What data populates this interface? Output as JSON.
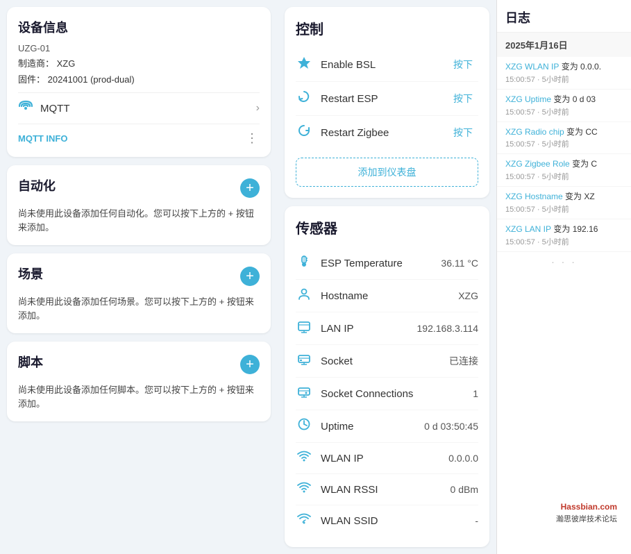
{
  "left": {
    "device_info": {
      "title": "设备信息",
      "model": "UZG-01",
      "manufacturer_label": "制造商：",
      "manufacturer": "XZG",
      "firmware_label": "固件：",
      "firmware": "20241001 (prod-dual)",
      "mqtt_label": "MQTT",
      "mqtt_info_label": "MQTT INFO"
    },
    "automation": {
      "title": "自动化",
      "text": "尚未使用此设备添加任何自动化。您可以按下上方的 + 按钮来添加。"
    },
    "scene": {
      "title": "场景",
      "text": "尚未使用此设备添加任何场景。您可以按下上方的 + 按钮来添加。"
    },
    "script": {
      "title": "脚本",
      "text": "尚未使用此设备添加任何脚本。您可以按下上方的 + 按钮来添加。"
    }
  },
  "center": {
    "control": {
      "title": "控制",
      "items": [
        {
          "label": "Enable BSL",
          "btn": "按下"
        },
        {
          "label": "Restart ESP",
          "btn": "按下"
        },
        {
          "label": "Restart Zigbee",
          "btn": "按下"
        }
      ],
      "add_dashboard": "添加到仪表盘"
    },
    "sensors": {
      "title": "传感器",
      "items": [
        {
          "label": "ESP Temperature",
          "value": "36.11 °C"
        },
        {
          "label": "Hostname",
          "value": "XZG"
        },
        {
          "label": "LAN IP",
          "value": "192.168.3.114"
        },
        {
          "label": "Socket",
          "value": "已连接"
        },
        {
          "label": "Socket Connections",
          "value": "1"
        },
        {
          "label": "Uptime",
          "value": "0 d 03:50:45"
        },
        {
          "label": "WLAN IP",
          "value": "0.0.0.0"
        },
        {
          "label": "WLAN RSSI",
          "value": "0 dBm"
        },
        {
          "label": "WLAN SSID",
          "value": "-"
        }
      ]
    }
  },
  "right": {
    "title": "日志",
    "date": "2025年1月16日",
    "entries": [
      {
        "key": "XZG WLAN IP",
        "change": "变为 0.0.0.",
        "time": "15:00:57 · 5小时前"
      },
      {
        "key": "XZG Uptime",
        "change": "变为 0 d 03",
        "time": "15:00:57 · 5小时前"
      },
      {
        "key": "XZG Radio chip",
        "change": "变为 CC",
        "time": "15:00:57 · 5小时前"
      },
      {
        "key": "XZG Zigbee Role",
        "change": "变为 C",
        "time": "15:00:57 · 5小时前"
      },
      {
        "key": "XZG Hostname",
        "change": "变为 XZ",
        "time": "15:00:57 · 5小时前"
      },
      {
        "key": "XZG LAN IP",
        "change": "变为 192.16",
        "time": "15:00:57 · 5小时前"
      }
    ],
    "dots": "· · ·"
  },
  "watermark": {
    "line1": "Hassbian.com",
    "line2": "瀚思彼岸技术论坛"
  },
  "icons": {
    "mqtt": "📡",
    "bsl": "⚡",
    "restart_esp": "🔄",
    "restart_zigbee": "🔃",
    "temperature": "🌡",
    "hostname": "👤",
    "lan_ip": "🖥",
    "socket": "🖥",
    "socket_conn": "🖥",
    "uptime": "🕐",
    "wlan_ip": "📶",
    "wlan_rssi": "📶",
    "wlan_ssid": "📶"
  }
}
